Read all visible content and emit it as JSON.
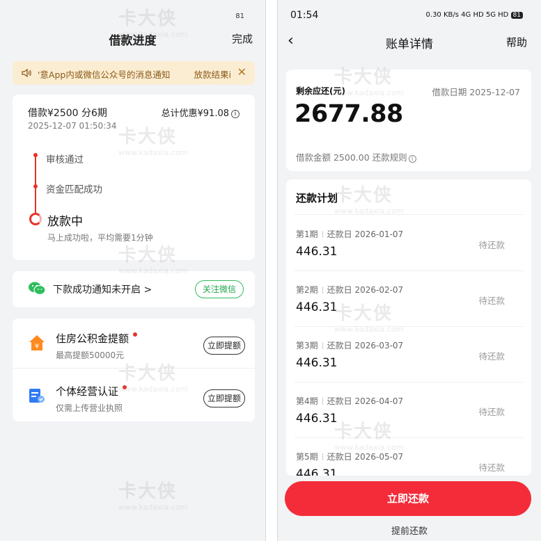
{
  "left": {
    "status": {
      "signal_text": "81"
    },
    "nav": {
      "title": "借款进度",
      "done_label": "完成"
    },
    "notice": {
      "text": "'意App内或微信公众号的消息通知",
      "result_text": "放款结果i",
      "close": "✕"
    },
    "loan": {
      "amount_label": "借款¥2500  分6期",
      "discount_label": "总计优惠¥91.08",
      "time": "2025-12-07 01:50:34"
    },
    "timeline": {
      "steps": [
        {
          "label": "审核通过"
        },
        {
          "label": "资金匹配成功"
        }
      ],
      "current": "放款中",
      "current_sub": "马上成功啦，平均需要1分钟"
    },
    "wechat": {
      "text": "下款成功通知未开启 >",
      "button": "关注微信"
    },
    "items": [
      {
        "title": "住房公积金提额",
        "subtitle": "最高提额50000元",
        "button": "立即提额"
      },
      {
        "title": "个体经营认证",
        "subtitle": "仅需上传营业执照",
        "button": "立即提额"
      }
    ]
  },
  "right": {
    "status": {
      "time": "01:54",
      "icons_text": "0.30 KB/s  4G HD  5G HD",
      "battery": "81"
    },
    "nav": {
      "back": "‹",
      "title": "账单详情",
      "help": "帮助"
    },
    "summary": {
      "label": "剩余应还(元)",
      "date": "借款日期 2025-12-07",
      "amount": "2677.88",
      "meta": "借款金额 2500.00    还款规则"
    },
    "plan": {
      "title": "还款计划",
      "installments": [
        {
          "period": "第1期",
          "due": "还款日 2026-01-07",
          "amount": "446.31",
          "status": "待还款"
        },
        {
          "period": "第2期",
          "due": "还款日 2026-02-07",
          "amount": "446.31",
          "status": "待还款"
        },
        {
          "period": "第3期",
          "due": "还款日 2026-03-07",
          "amount": "446.31",
          "status": "待还款"
        },
        {
          "period": "第4期",
          "due": "还款日 2026-04-07",
          "amount": "446.31",
          "status": "待还款"
        },
        {
          "period": "第5期",
          "due": "还款日 2026-05-07",
          "amount": "446.31",
          "status": "待还款"
        }
      ]
    },
    "pay_button": "立即还款",
    "early_label": "提前还款"
  },
  "watermark": {
    "brand": "卡大侠",
    "url": "www.kadaxia.com"
  },
  "colors": {
    "accent_red": "#e7322a",
    "pay_red": "#f42c39",
    "wechat_green": "#2fbd5c",
    "notice_bg": "#fbedd2"
  }
}
